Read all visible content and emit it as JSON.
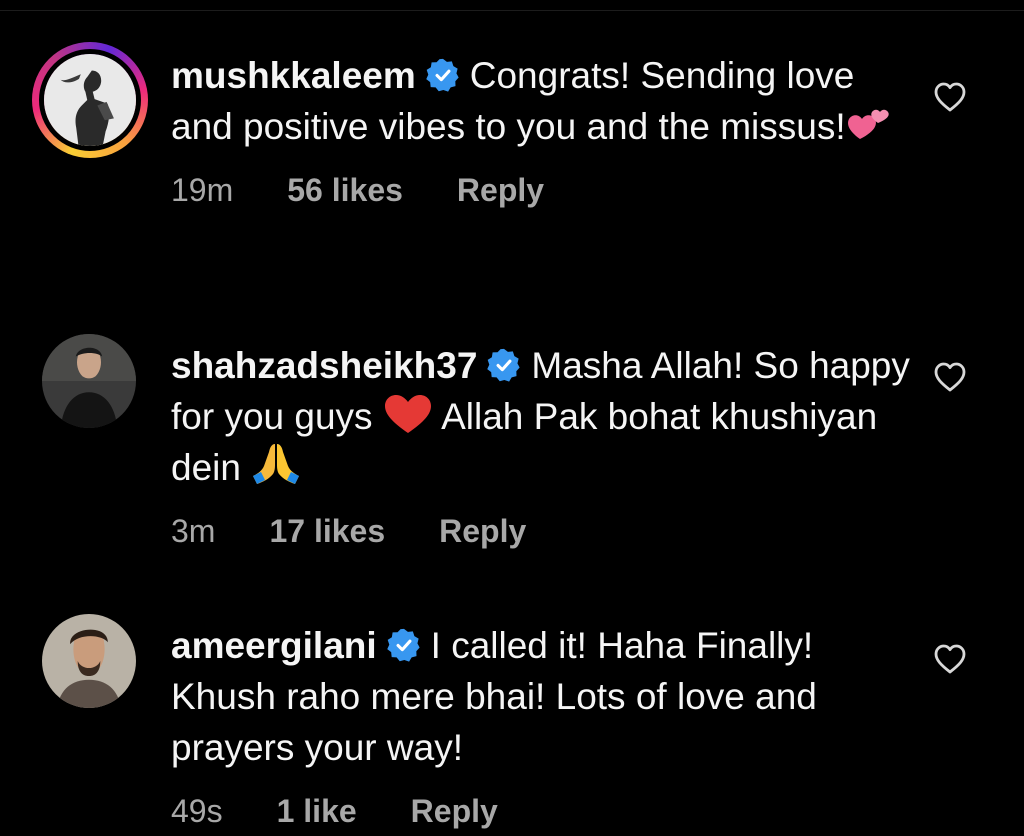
{
  "comments": [
    {
      "username": "mushkkaleem",
      "verified": true,
      "text_before_emoji": "Congrats! Sending love and positive vibes to you and the missus!",
      "emoji": "two-hearts",
      "text_after_emoji": "",
      "time": "19m",
      "likes": "56 likes",
      "reply": "Reply",
      "has_story_ring": true
    },
    {
      "username": "shahzadsheikh37",
      "verified": true,
      "text_part1": "Masha Allah! So happy for you guys",
      "emoji1": "red-heart",
      "text_part2": "Allah Pak bohat khushiyan dein",
      "emoji2": "folded-hands",
      "time": "3m",
      "likes": "17 likes",
      "reply": "Reply",
      "has_story_ring": false
    },
    {
      "username": "ameergilani",
      "verified": true,
      "text": "I called it! Haha Finally! Khush raho mere bhai! Lots of love and prayers your way!",
      "time": "49s",
      "likes": "1 like",
      "reply": "Reply",
      "has_story_ring": false
    }
  ],
  "colors": {
    "background": "#000000",
    "text": "#f5f5f5",
    "meta": "#a8a8a8",
    "verified": "#3897f0"
  },
  "icons": [
    "verified-badge-icon",
    "heart-outline-icon"
  ]
}
